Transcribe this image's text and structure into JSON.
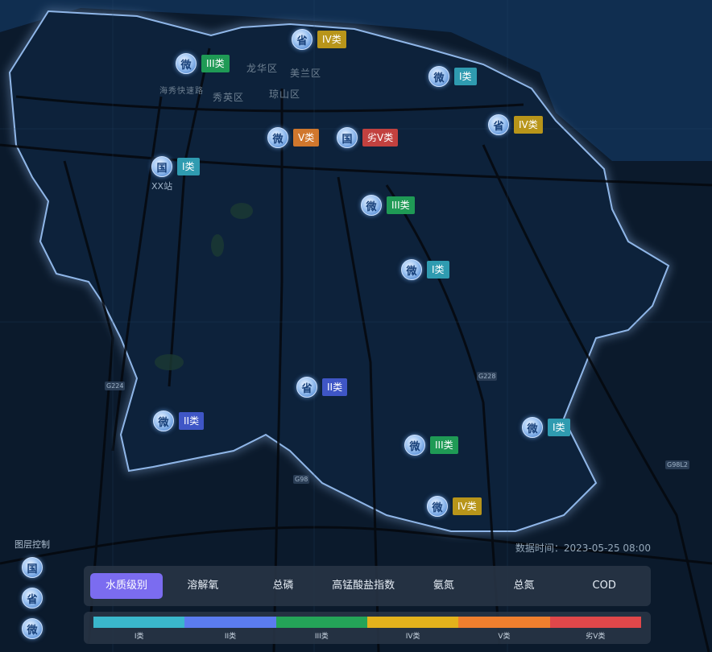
{
  "colors": {
    "I": "#2f9bb0",
    "II": "#3f56c6",
    "III": "#1f9a55",
    "IV": "#b8951a",
    "V": "#d0772d",
    "VI": "#c2413f"
  },
  "districts": [
    "龙华区",
    "美兰区",
    "秀英区",
    "琼山区",
    "海秀快速路"
  ],
  "road_labels": [
    "G224",
    "G98",
    "G228",
    "G98L2"
  ],
  "stations": [
    {
      "type": "省",
      "grade": "IV类",
      "color_key": "IV"
    },
    {
      "type": "微",
      "grade": "III类",
      "color_key": "III"
    },
    {
      "type": "微",
      "grade": "I类",
      "color_key": "I"
    },
    {
      "type": "省",
      "grade": "IV类",
      "color_key": "IV"
    },
    {
      "type": "微",
      "grade": "V类",
      "color_key": "V"
    },
    {
      "type": "国",
      "grade": "劣V类",
      "color_key": "VI"
    },
    {
      "type": "国",
      "grade": "I类",
      "color_key": "I",
      "name": "XX站"
    },
    {
      "type": "微",
      "grade": "III类",
      "color_key": "III"
    },
    {
      "type": "微",
      "grade": "I类",
      "color_key": "I"
    },
    {
      "type": "省",
      "grade": "II类",
      "color_key": "II"
    },
    {
      "type": "微",
      "grade": "II类",
      "color_key": "II"
    },
    {
      "type": "微",
      "grade": "III类",
      "color_key": "III"
    },
    {
      "type": "微",
      "grade": "I类",
      "color_key": "I"
    },
    {
      "type": "微",
      "grade": "IV类",
      "color_key": "IV"
    }
  ],
  "timestamp": "数据时间：2023-05-25 08:00",
  "layer_control": {
    "title": "图层控制",
    "items": [
      "国",
      "省",
      "微"
    ]
  },
  "tabs": [
    "水质级别",
    "溶解氧",
    "总磷",
    "高锰酸盐指数",
    "氨氮",
    "总氮",
    "COD"
  ],
  "active_tab": "水质级别",
  "legend": [
    {
      "label": "I类",
      "color": "#3ab7cc"
    },
    {
      "label": "II类",
      "color": "#5b7cf0"
    },
    {
      "label": "III类",
      "color": "#24a458"
    },
    {
      "label": "IV类",
      "color": "#e3b21c"
    },
    {
      "label": "V类",
      "color": "#f07f2e"
    },
    {
      "label": "劣V类",
      "color": "#e0474a"
    }
  ]
}
